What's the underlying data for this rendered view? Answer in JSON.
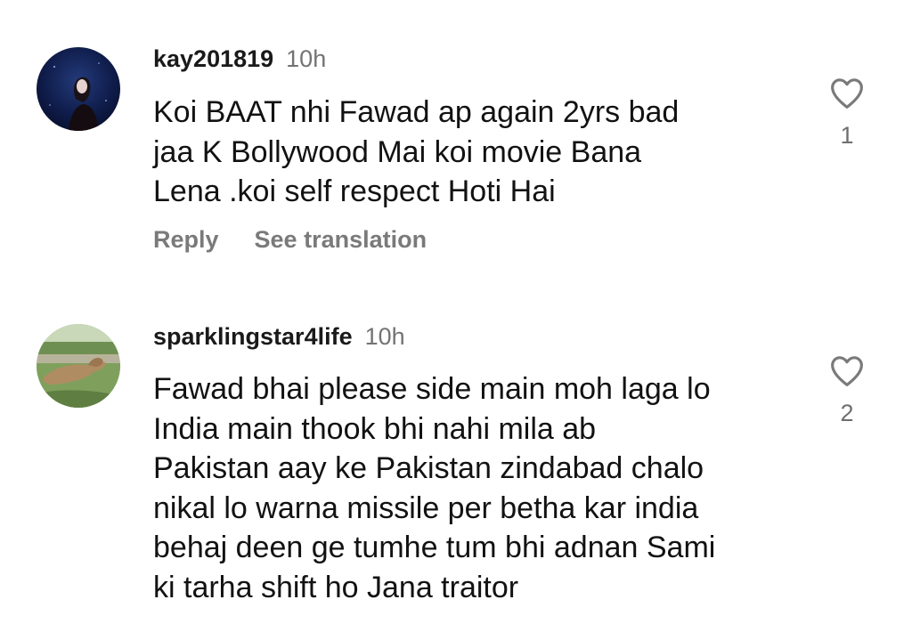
{
  "comments": [
    {
      "username": "kay201819",
      "time": "10h",
      "text_lines": [
        "Koi BAAT nhi Fawad ap again 2yrs bad",
        "jaa K Bollywood Mai koi movie Bana",
        "Lena .koi self respect Hoti Hai"
      ],
      "likes": "1",
      "reply_label": "Reply",
      "translate_label": "See translation",
      "avatar_icon": "avatar-dark-portrait"
    },
    {
      "username": "sparklingstar4life",
      "time": "10h",
      "text_lines": [
        "Fawad bhai please side main moh laga lo",
        "India main thook bhi nahi mila ab",
        "Pakistan aay ke Pakistan zindabad chalo",
        "nikal lo warna missile per betha kar india",
        "behaj deen ge tumhe tum bhi adnan Sami",
        "ki tarha shift ho Jana traitor"
      ],
      "likes": "2",
      "avatar_icon": "avatar-lion-outdoor"
    }
  ],
  "icons": {
    "like": "heart-outline-icon"
  },
  "colors": {
    "background": "#ffffff",
    "text": "#121212",
    "muted": "#737373"
  }
}
